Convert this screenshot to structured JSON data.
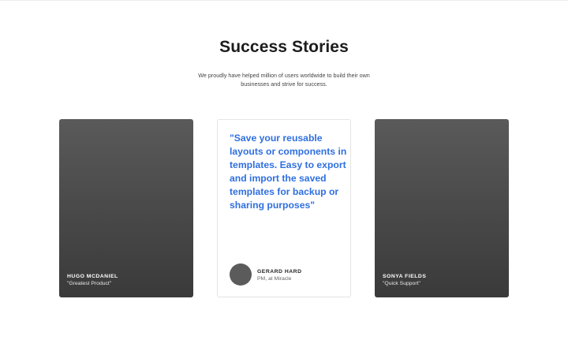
{
  "section": {
    "title": "Success Stories",
    "subtitle": "We proudly have helped million of users worldwide to build their own businesses and strive for success."
  },
  "testimonials": [
    {
      "type": "photo",
      "name": "HUGO MCDANIEL",
      "role": "\"Greatest Product\""
    },
    {
      "type": "quote",
      "quote": "\"Save your reusable layouts or components in templates. Easy to export and import the saved templates for backup or sharing purposes\"",
      "name": "GERARD HARD",
      "role": "PM, at Miracle"
    },
    {
      "type": "photo",
      "name": "SONYA FIELDS",
      "role": "\"Quick Support\""
    }
  ],
  "colors": {
    "quote_accent": "#2f6fe0",
    "photo_card": "#4b4b4b"
  }
}
